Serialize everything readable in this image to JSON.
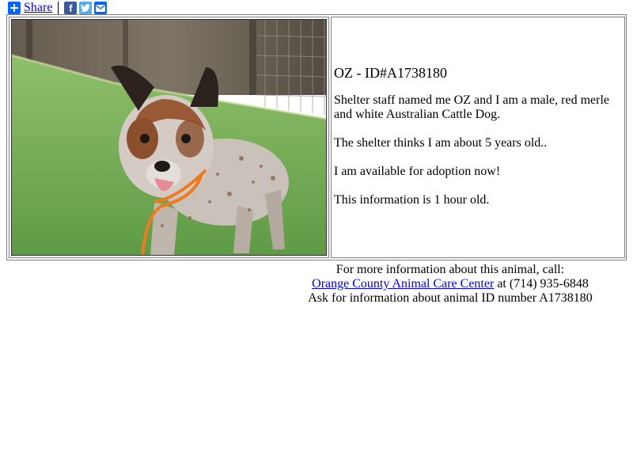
{
  "share": {
    "plus_icon": "plus-icon",
    "label": "Share",
    "buttons": [
      "facebook-icon",
      "twitter-icon",
      "email-icon"
    ],
    "brand_color": "#0166ff"
  },
  "animal": {
    "photo_alt": "Photo of OZ",
    "title": "OZ - ID#A1738180",
    "description": "Shelter staff named me OZ and I am a male, red merle and white Australian Cattle Dog.",
    "age": "The shelter thinks I am about 5 years old..",
    "availability": "I am available for adoption now!",
    "freshness": "This information is 1 hour old."
  },
  "contact": {
    "line1": "For more information about this animal, call:",
    "shelter_name": "Orange County Animal Care Center",
    "at_phone": " at (714) 935-6848",
    "line3": "Ask for information about animal ID number A1738180"
  }
}
